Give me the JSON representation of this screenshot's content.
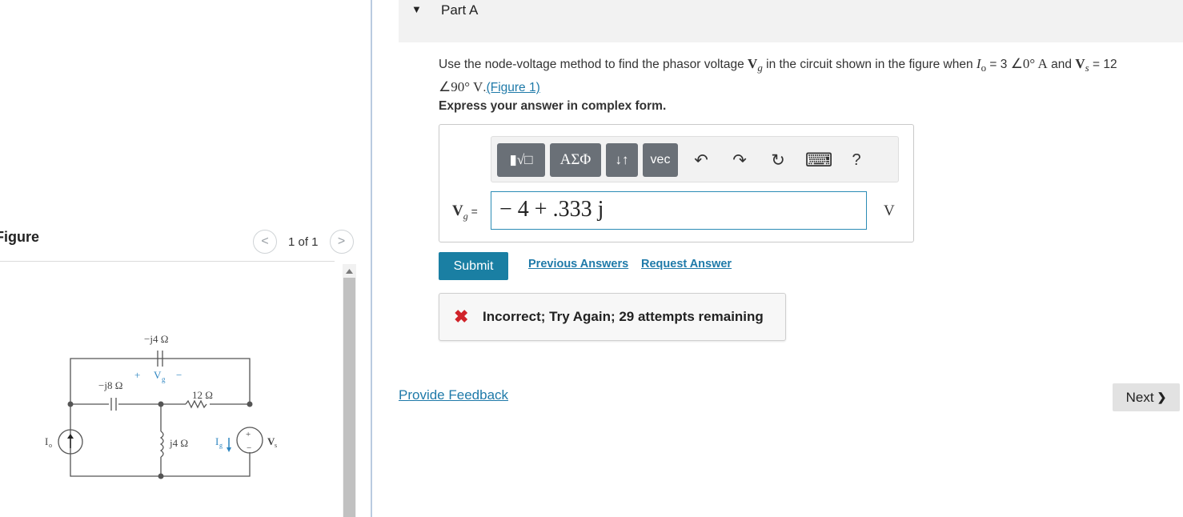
{
  "figure_panel": {
    "title": "Figure",
    "pager_prev": "<",
    "pager_text": "1 of 1",
    "pager_next": ">",
    "circuit_labels": {
      "cap_top": "−j4 Ω",
      "vg_plus": "+",
      "vg": "V",
      "vg_sub": "g",
      "vg_minus": "−",
      "cap_left": "−j8 Ω",
      "res": "12 Ω",
      "ind": "j4 Ω",
      "io": "I",
      "io_sub": "o",
      "is": "I",
      "is_sub": "g",
      "vs": "V",
      "vs_sub": "s",
      "vs_plus": "+",
      "vs_minus": "−"
    }
  },
  "part": {
    "caret": "▼",
    "title": "Part A"
  },
  "question": {
    "p1": "Use the node-voltage method to find the phasor voltage ",
    "vg": "V",
    "vg_sub": "g",
    "p2": " in the circuit shown in the figure when ",
    "io": "I",
    "io_sub": "o",
    "p3": " = 3 ",
    "io_val": "∠0° A",
    "p4": " and ",
    "vs": "V",
    "vs_sub": "s",
    "p5": " = 12 ",
    "vs_val": "∠90° V",
    "p6": ".",
    "figure_link": "(Figure 1)",
    "instruction": "Express your answer in complex form."
  },
  "answer": {
    "toolbar": {
      "templates_label": "▮√□",
      "greek_label": "ΑΣΦ",
      "arrows_label": "↓↑",
      "vec_label": "vec",
      "undo_icon": "↶",
      "redo_icon": "↷",
      "reset_icon": "↻",
      "keyboard_icon": "⌨",
      "help_icon": "?"
    },
    "label": "V",
    "label_sub": "g",
    "label_eq": " =",
    "value": "− 4 + .333 j",
    "unit": "V"
  },
  "actions": {
    "submit": "Submit",
    "previous_answers": "Previous Answers",
    "request_answer": "Request Answer"
  },
  "feedback": {
    "icon": "✖",
    "message": "Incorrect; Try Again; 29 attempts remaining"
  },
  "footer": {
    "provide_feedback": "Provide Feedback",
    "next": "Next",
    "next_icon": "❯"
  },
  "colors": {
    "accent": "#1a7fa3",
    "link": "#1f7aa9",
    "error": "#d0232a",
    "toolbar_button": "#6a7077"
  }
}
